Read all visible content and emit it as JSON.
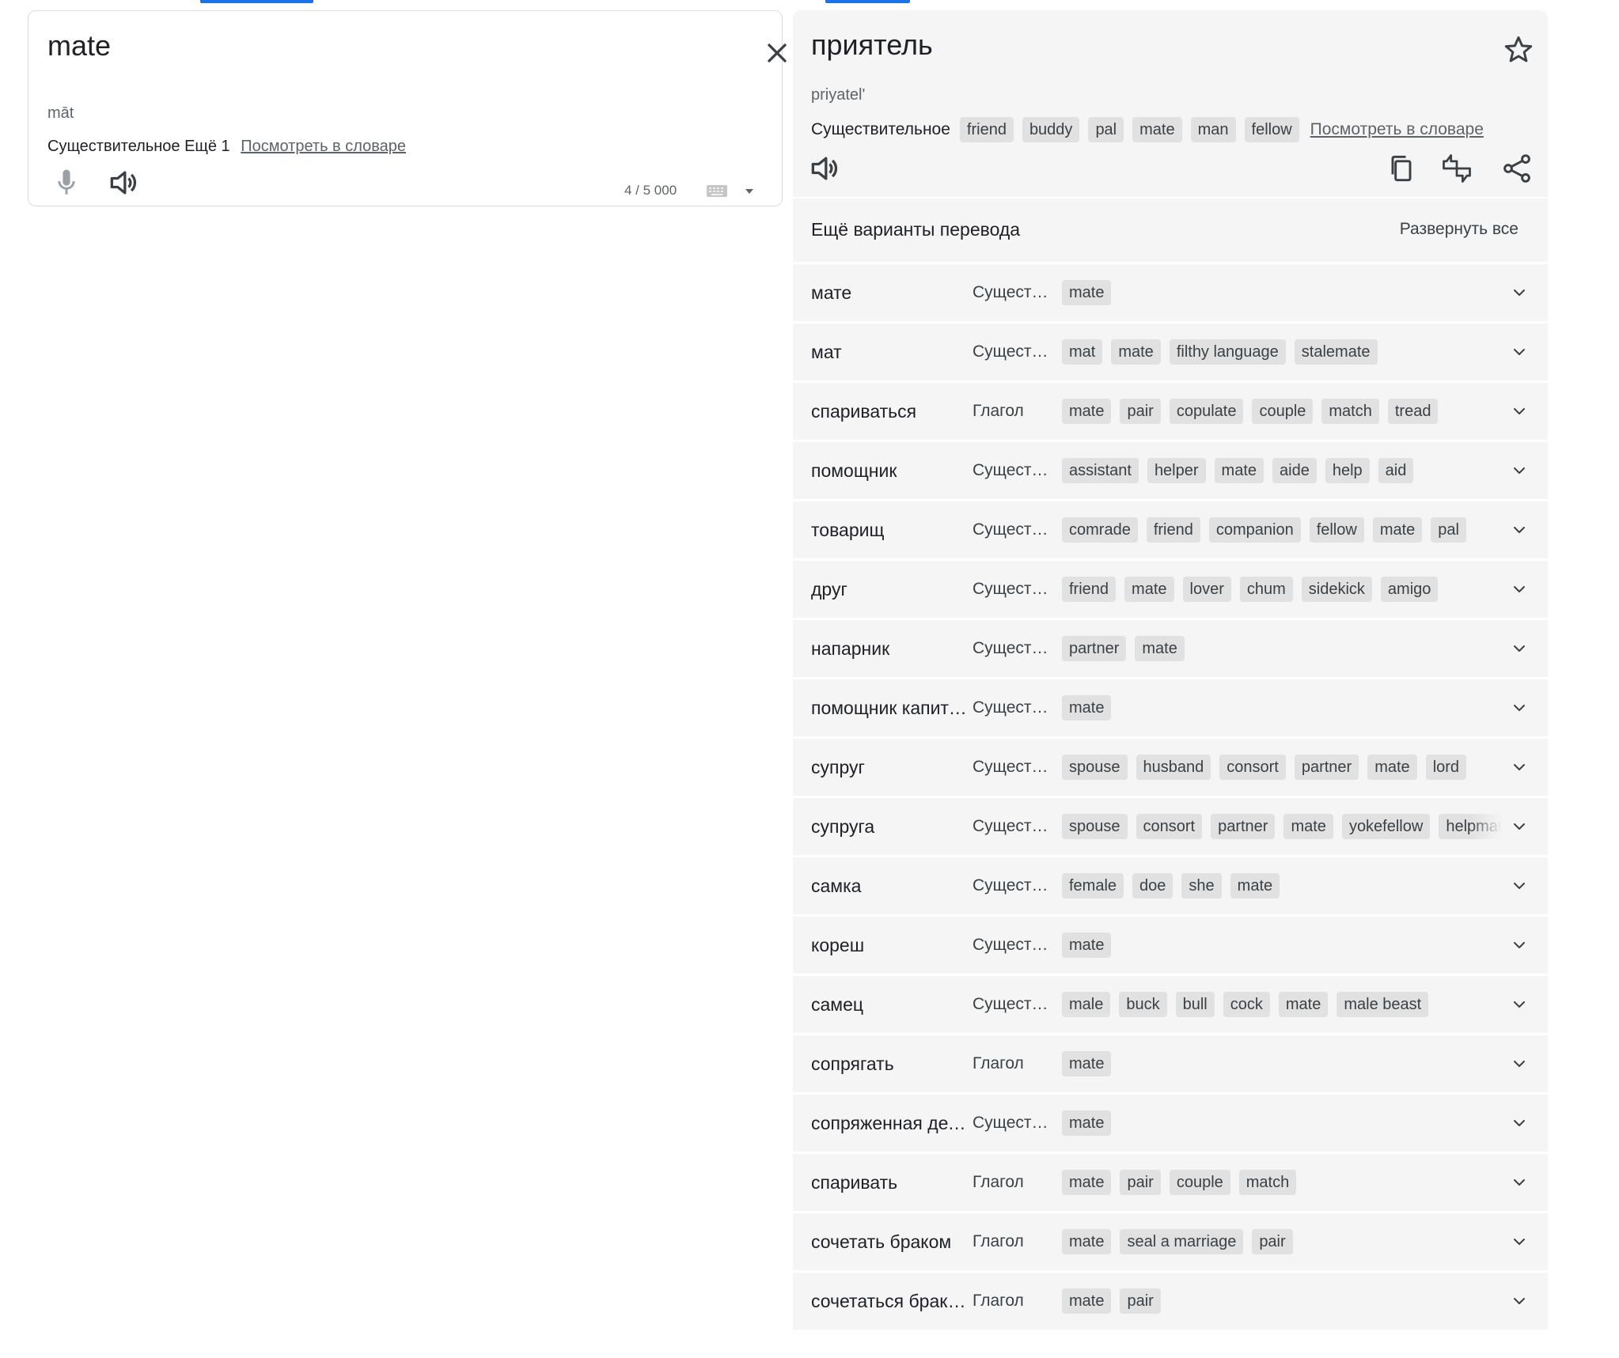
{
  "source": {
    "text": "mate",
    "transliteration": "māt",
    "dictionary_pos": "Существительное Ещё 1",
    "dictionary_link": "Посмотреть в словаре",
    "char_count": "4 / 5 000"
  },
  "target": {
    "text": "приятель",
    "transliteration": "priyatel'",
    "dictionary_pos": "Существительное",
    "dictionary_chips": [
      "friend",
      "buddy",
      "pal",
      "mate",
      "man",
      "fellow"
    ],
    "dictionary_link": "Посмотреть в словаре"
  },
  "alternatives": {
    "title": "Ещё варианты перевода",
    "expand_all": "Развернуть все",
    "rows": [
      {
        "word": "мате",
        "pos": "Существительное",
        "chips": [
          "mate"
        ]
      },
      {
        "word": "мат",
        "pos": "Существительное",
        "chips": [
          "mat",
          "mate",
          "filthy language",
          "stalemate"
        ]
      },
      {
        "word": "спариваться",
        "pos": "Глагол",
        "chips": [
          "mate",
          "pair",
          "copulate",
          "couple",
          "match",
          "tread"
        ]
      },
      {
        "word": "помощник",
        "pos": "Существительное",
        "chips": [
          "assistant",
          "helper",
          "mate",
          "aide",
          "help",
          "aid"
        ]
      },
      {
        "word": "товарищ",
        "pos": "Существительное",
        "chips": [
          "comrade",
          "friend",
          "companion",
          "fellow",
          "mate",
          "pal"
        ]
      },
      {
        "word": "друг",
        "pos": "Существительное",
        "chips": [
          "friend",
          "mate",
          "lover",
          "chum",
          "sidekick",
          "amigo"
        ]
      },
      {
        "word": "напарник",
        "pos": "Существительное",
        "chips": [
          "partner",
          "mate"
        ]
      },
      {
        "word": "помощник капитана",
        "pos": "Существительное",
        "chips": [
          "mate"
        ]
      },
      {
        "word": "супруг",
        "pos": "Существительное",
        "chips": [
          "spouse",
          "husband",
          "consort",
          "partner",
          "mate",
          "lord"
        ]
      },
      {
        "word": "супруга",
        "pos": "Существительное",
        "chips": [
          "spouse",
          "consort",
          "partner",
          "mate",
          "yokefellow",
          "helpmate"
        ]
      },
      {
        "word": "самка",
        "pos": "Существительное",
        "chips": [
          "female",
          "doe",
          "she",
          "mate"
        ]
      },
      {
        "word": "кореш",
        "pos": "Существительное",
        "chips": [
          "mate"
        ]
      },
      {
        "word": "самец",
        "pos": "Существительное",
        "chips": [
          "male",
          "buck",
          "bull",
          "cock",
          "mate",
          "male beast"
        ]
      },
      {
        "word": "сопрягать",
        "pos": "Глагол",
        "chips": [
          "mate"
        ]
      },
      {
        "word": "сопряженная деталь",
        "pos": "Существительное",
        "chips": [
          "mate"
        ]
      },
      {
        "word": "спаривать",
        "pos": "Глагол",
        "chips": [
          "mate",
          "pair",
          "couple",
          "match"
        ]
      },
      {
        "word": "сочетать браком",
        "pos": "Глагол",
        "chips": [
          "mate",
          "seal a marriage",
          "pair"
        ]
      },
      {
        "word": "сочетаться браком",
        "pos": "Глагол",
        "chips": [
          "mate",
          "pair"
        ]
      }
    ]
  },
  "icons": {
    "clear": "close-icon",
    "mic": "mic-icon",
    "listen": "volume-icon",
    "keyboard": "keyboard-icon",
    "star": "star-icon",
    "copy": "copy-icon",
    "feedback": "thumbs-feedback-icon",
    "share": "share-icon",
    "expand": "chevron-down-icon"
  },
  "colors": {
    "accent": "#1a73e8",
    "panel_bg": "#f5f5f5",
    "chip_bg": "#e1e1e1"
  }
}
